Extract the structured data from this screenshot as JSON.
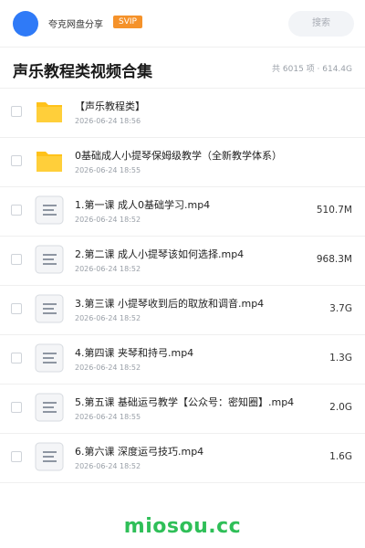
{
  "header": {
    "user_name": "夸克网盘分享",
    "badge": "SVIP",
    "search_placeholder": "搜索"
  },
  "page": {
    "title": "声乐教程类视频合集",
    "meta": "共 6015 项 · 614.4G"
  },
  "files": [
    {
      "type": "folder",
      "name": "【声乐教程类】",
      "date": "2026-06-24 18:56",
      "size": ""
    },
    {
      "type": "folder",
      "name": "0基础成人小提琴保姆级教学（全新教学体系）",
      "date": "2026-06-24 18:55",
      "size": ""
    },
    {
      "type": "file",
      "name": "1.第一课 成人0基础学习.mp4",
      "date": "2026-06-24 18:52",
      "size": "510.7M"
    },
    {
      "type": "file",
      "name": "2.第二课 成人小提琴该如何选择.mp4",
      "date": "2026-06-24 18:52",
      "size": "968.3M"
    },
    {
      "type": "file",
      "name": "3.第三课 小提琴收到后的取放和调音.mp4",
      "date": "2026-06-24 18:52",
      "size": "3.7G"
    },
    {
      "type": "file",
      "name": "4.第四课 夹琴和持弓.mp4",
      "date": "2026-06-24 18:52",
      "size": "1.3G"
    },
    {
      "type": "file",
      "name": "5.第五课 基础运弓教学【公众号：密知圈】.mp4",
      "date": "2026-06-24 18:55",
      "size": "2.0G"
    },
    {
      "type": "file",
      "name": "6.第六课 深度运弓技巧.mp4",
      "date": "2026-06-24 18:52",
      "size": "1.6G"
    }
  ],
  "icons": {
    "folder": "folder-icon",
    "file": "document-icon"
  },
  "colors": {
    "accent": "#2f7af7",
    "badge": "#f5922a",
    "folder": "#ffc21a",
    "watermark": "#2fbf58"
  },
  "watermark": "miosou.cc"
}
